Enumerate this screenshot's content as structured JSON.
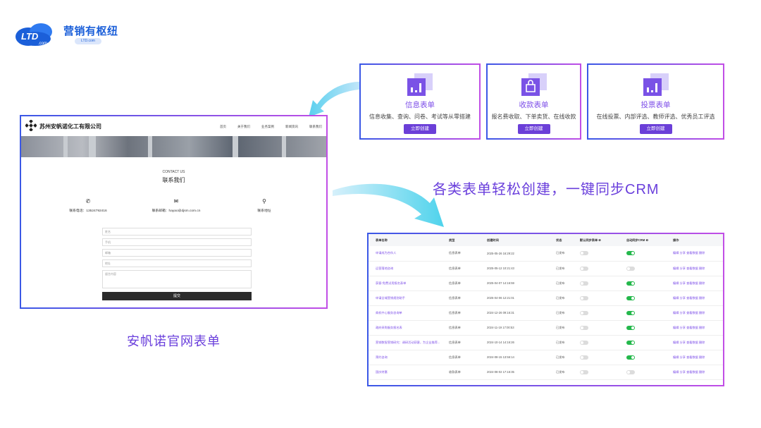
{
  "brand": {
    "name": "营销有枢纽",
    "sub": "LTD.com",
    "mark": "LTD",
    "mark_sub": ".com"
  },
  "cards": [
    {
      "title": "信息表单",
      "desc": "信息收集、查询、问卷、考试等从零搭建",
      "button": "立即创建",
      "icon": "bar-chart-icon"
    },
    {
      "title": "收款表单",
      "desc": "报名费收取、下单卖货、在线收款",
      "button": "立即创建",
      "icon": "shopping-bag-icon"
    },
    {
      "title": "投票表单",
      "desc": "在线投票、内部评选、教师评选、优秀员工评选",
      "button": "立即创建",
      "icon": "bar-chart-icon"
    }
  ],
  "slogan": "各类表单轻松创建，一键同步CRM",
  "caption": "安帆诺官网表单",
  "site": {
    "company": "苏州安帆诺化工有限公司",
    "nav": [
      "首页",
      "关于我们",
      "业务案例",
      "新闻资讯",
      "联系我们"
    ],
    "contact_en": "CONTACT US",
    "contact_cn": "联系我们",
    "contacts": [
      {
        "icon": "phone-icon",
        "glyph": "✆",
        "text": "联系电话：13524792416"
      },
      {
        "icon": "mail-icon",
        "glyph": "✉",
        "text": "联系邮箱：hayao@djsm.com.cn"
      },
      {
        "icon": "location-icon",
        "glyph": "⚲",
        "text": "联系地址"
      }
    ],
    "fields": [
      "姓名",
      "手机",
      "邮箱",
      "地址",
      "留言内容"
    ],
    "submit": "提交"
  },
  "table": {
    "headers": [
      "表单名称",
      "类型",
      "创建时间",
      "状态",
      "默认同步表单 ❶",
      "自动同步CRM ❶",
      "操作"
    ],
    "rows": [
      {
        "name": "申请成为合伙人",
        "type": "信息表单",
        "time": "2025-05-26 16:29:22",
        "status": "已发布",
        "default": false,
        "crm": true,
        "ops": "编辑  分享  查看数据  删除"
      },
      {
        "name": "运营落地咨询",
        "type": "信息表单",
        "time": "2025-05-12 10:21:43",
        "status": "已发布",
        "default": false,
        "crm": false,
        "ops": "编辑  分享  查看数据  删除"
      },
      {
        "name": "获客-免费试用报名表单",
        "type": "信息表单",
        "time": "2025-04-07 14:16:59",
        "status": "已发布",
        "default": false,
        "crm": true,
        "ops": "编辑  分享  查看数据  删除"
      },
      {
        "name": "申请全域营销规划助手",
        "type": "信息表单",
        "time": "2025-04-06 12:21:01",
        "status": "已发布",
        "default": false,
        "crm": true,
        "ops": "编辑  分享  查看数据  删除"
      },
      {
        "name": "商机中心服务咨询单",
        "type": "信息表单",
        "time": "2024-12-26 09:16:31",
        "status": "已发布",
        "default": false,
        "crm": true,
        "ops": "编辑  分享  查看数据  删除"
      },
      {
        "name": "政府采购服务报名表",
        "type": "信息表单",
        "time": "2024-11-19 17:00:53",
        "status": "已发布",
        "default": false,
        "crm": true,
        "ops": "编辑  分享  查看数据  删除"
      },
      {
        "name": "营销数智营销研究：调研活动获客，为企业推荐...",
        "type": "信息表单",
        "time": "2024-10-14 14:16:26",
        "status": "已发布",
        "default": false,
        "crm": true,
        "ops": "编辑  分享  查看数据  删除"
      },
      {
        "name": "预约咨询",
        "type": "信息表单",
        "time": "2024-08-15 13:56:14",
        "status": "已发布",
        "default": false,
        "crm": true,
        "ops": "编辑  分享  查看数据  删除"
      },
      {
        "name": "国庆特惠",
        "type": "收款表单",
        "time": "2024-08-02 17:16:35",
        "status": "已发布",
        "default": false,
        "crm": false,
        "ops": "编辑  分享  查看数据  删除"
      }
    ]
  },
  "colors": {
    "accent": "#6a3fdc",
    "border_start": "#3b58e6",
    "border_end": "#c14ee6",
    "brand": "#1b5fd9",
    "toggle_on": "#25b84c"
  }
}
